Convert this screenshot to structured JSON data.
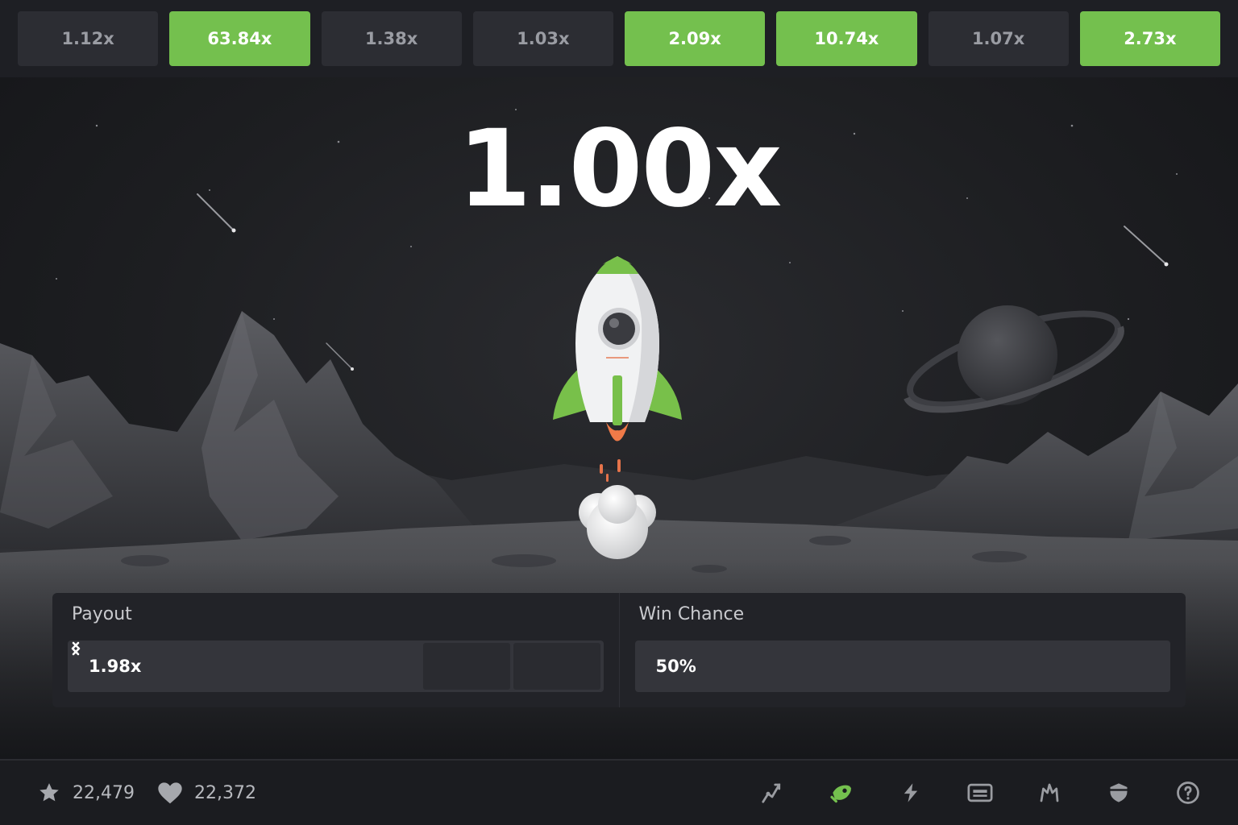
{
  "history": [
    {
      "label": "1.12x",
      "win": false
    },
    {
      "label": "63.84x",
      "win": true
    },
    {
      "label": "1.38x",
      "win": false
    },
    {
      "label": "1.03x",
      "win": false
    },
    {
      "label": "2.09x",
      "win": true
    },
    {
      "label": "10.74x",
      "win": true
    },
    {
      "label": "1.07x",
      "win": false
    },
    {
      "label": "2.73x",
      "win": true
    }
  ],
  "game": {
    "multiplier": "1.00x"
  },
  "controls": {
    "payout_label": "Payout",
    "payout_value": "1.98x",
    "win_chance_label": "Win Chance",
    "win_chance_value": "50%"
  },
  "footer": {
    "favorites_count": "22,479",
    "likes_count": "22,372",
    "icons": [
      "chart-line-icon",
      "rocket-icon",
      "lightning-icon",
      "keyboard-icon",
      "fairness-icon",
      "shield-icon",
      "help-icon"
    ]
  },
  "colors": {
    "accent_green": "#74c04e",
    "pill_neutral": "#2c2d33",
    "background": "#16171b"
  }
}
